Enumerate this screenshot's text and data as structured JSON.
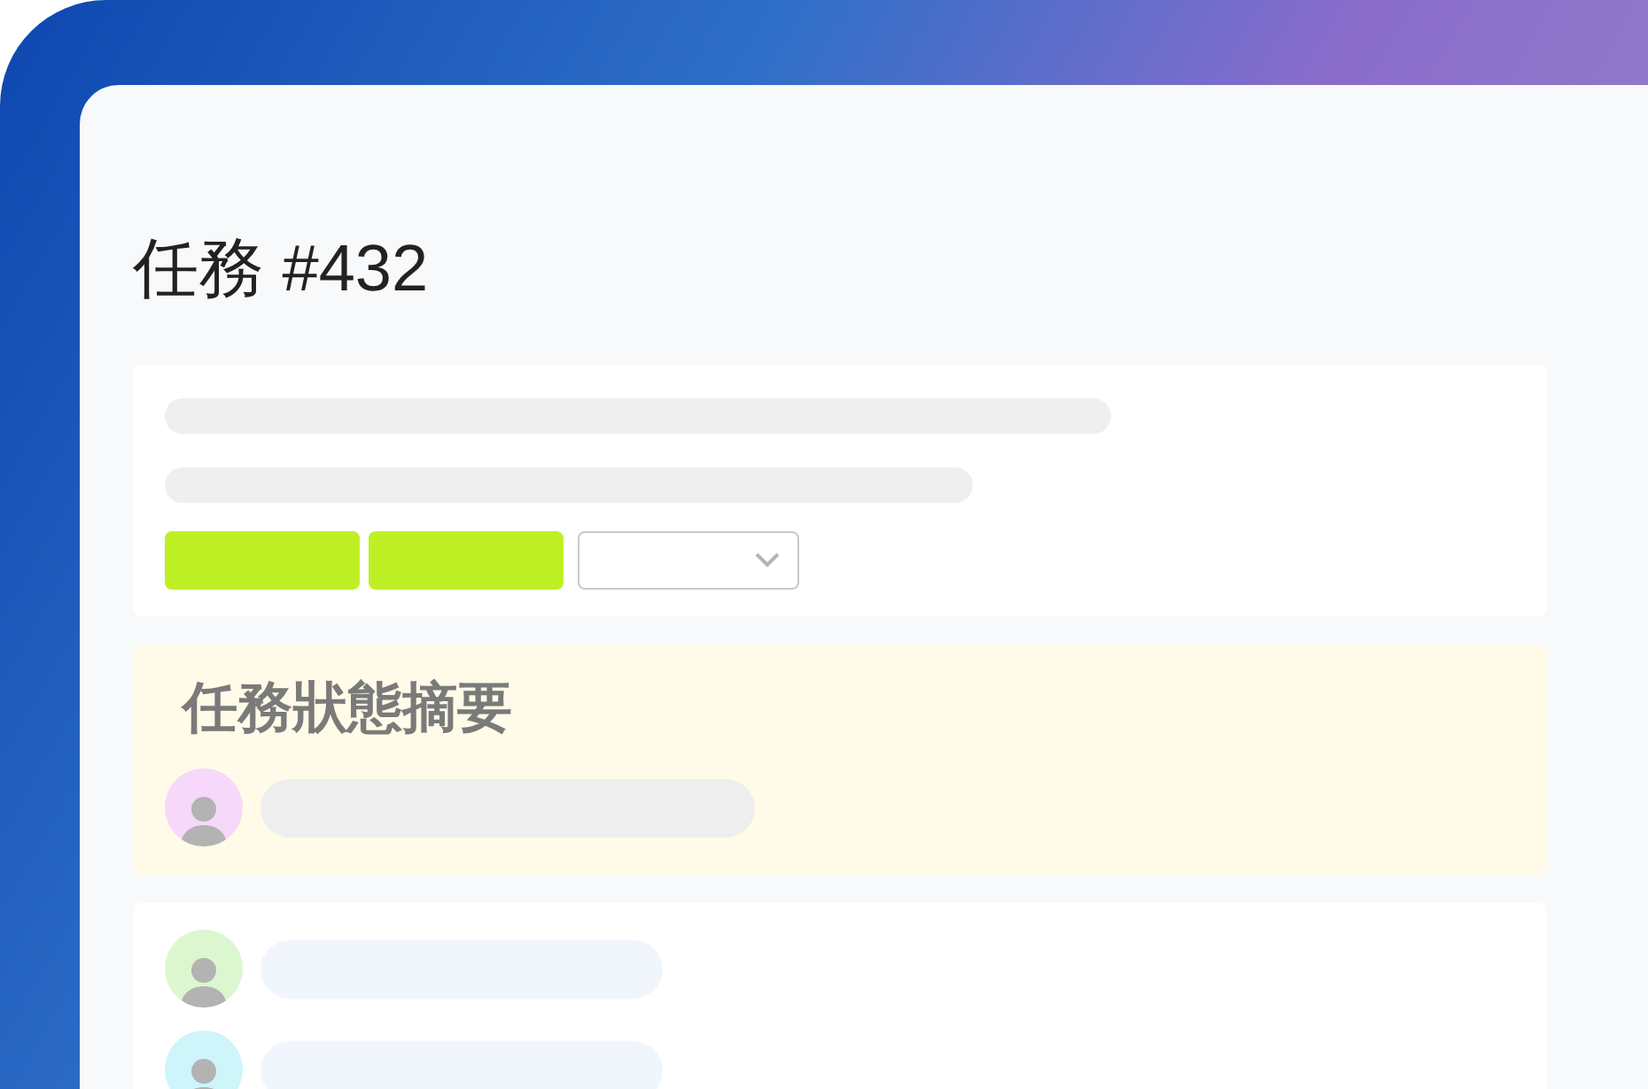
{
  "title": "任務 #432",
  "summary": {
    "heading": "任務狀態摘要",
    "members": [
      {
        "color": "#f6d8fa"
      }
    ]
  },
  "members": [
    {
      "color": "#dcf7cf"
    },
    {
      "color": "#cdf5fa"
    }
  ]
}
